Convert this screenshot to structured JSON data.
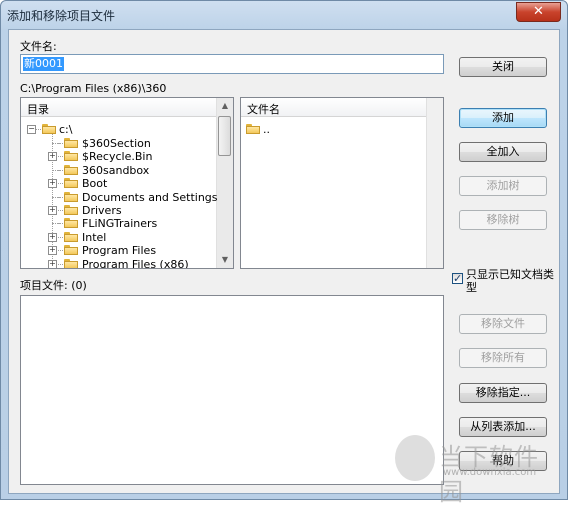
{
  "window": {
    "title": "添加和移除项目文件",
    "close_glyph": "✕"
  },
  "filename": {
    "label": "文件名:",
    "value": "新0001"
  },
  "current_path": "C:\\Program Files (x86)\\360",
  "dir_tree": {
    "header": "目录",
    "root": "c:\\",
    "items": [
      {
        "label": "$360Section",
        "expandable": false
      },
      {
        "label": "$Recycle.Bin",
        "expandable": true
      },
      {
        "label": "360sandbox",
        "expandable": false
      },
      {
        "label": "Boot",
        "expandable": true
      },
      {
        "label": "Documents and Settings",
        "expandable": false
      },
      {
        "label": "Drivers",
        "expandable": true
      },
      {
        "label": "FLiNGTrainers",
        "expandable": false
      },
      {
        "label": "Intel",
        "expandable": true
      },
      {
        "label": "Program Files",
        "expandable": true
      },
      {
        "label": "Program Files (x86)",
        "expandable": true
      }
    ]
  },
  "file_list": {
    "header": "文件名",
    "items": [
      ".."
    ]
  },
  "project_files": {
    "label": "项目文件: (0)"
  },
  "buttons": {
    "close": "关闭",
    "add": "添加",
    "add_all": "全加入",
    "add_tree": "添加树",
    "remove_tree": "移除树",
    "remove_file": "移除文件",
    "remove_all": "移除所有",
    "remove_specified": "移除指定...",
    "add_from_list": "从列表添加...",
    "help": "帮助"
  },
  "show_known_types": {
    "label": "只显示已知文档类型",
    "checked": true
  },
  "watermark": {
    "text": "当下软件园",
    "url": "www.downxia.com"
  },
  "colors": {
    "selection": "#3399ff",
    "title_gradient": "#cfdff0",
    "close_red": "#c9432c"
  }
}
